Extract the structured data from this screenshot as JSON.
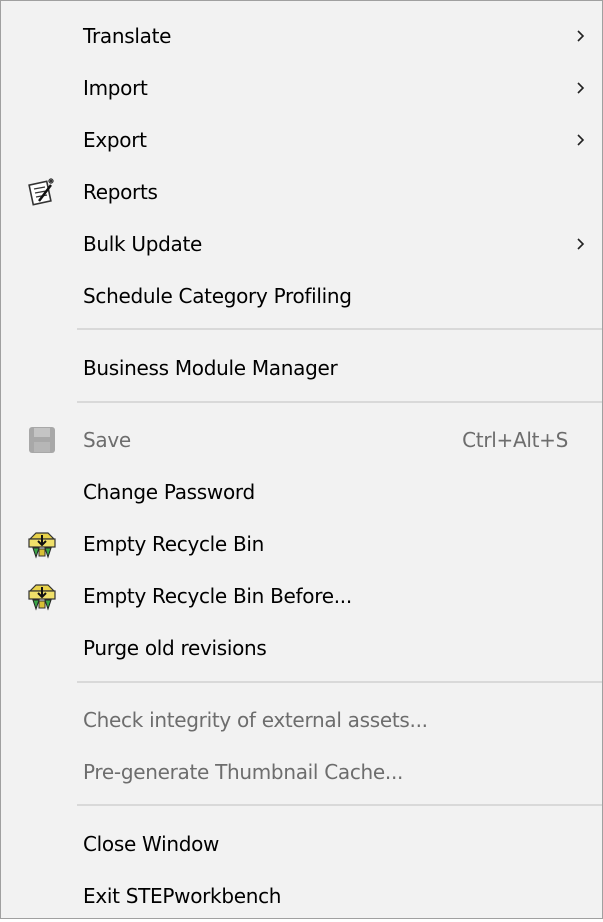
{
  "menu": {
    "items": {
      "translate": {
        "label": "Translate"
      },
      "import": {
        "label": "Import"
      },
      "export": {
        "label": "Export"
      },
      "reports": {
        "label": "Reports"
      },
      "bulk_update": {
        "label": "Bulk Update"
      },
      "schedule_category_profiling": {
        "label": "Schedule Category Profiling"
      },
      "business_module_manager": {
        "label": "Business Module Manager"
      },
      "save": {
        "label": "Save",
        "shortcut": "Ctrl+Alt+S"
      },
      "change_password": {
        "label": "Change Password"
      },
      "empty_recycle_bin": {
        "label": "Empty Recycle Bin"
      },
      "empty_recycle_bin_before": {
        "label": "Empty Recycle Bin Before..."
      },
      "purge_old_revisions": {
        "label": "Purge old revisions"
      },
      "check_integrity": {
        "label": "Check integrity of external assets..."
      },
      "pregenerate_thumbnail_cache": {
        "label": "Pre-generate Thumbnail Cache..."
      },
      "close_window": {
        "label": "Close Window"
      },
      "exit": {
        "label": "Exit STEPworkbench"
      }
    },
    "icons": {
      "reports": "report-wand-icon",
      "save": "save-disk-icon",
      "empty_recycle_bin": "recycle-bin-icon",
      "empty_recycle_bin_before": "recycle-bin-icon",
      "submenu": "chevron-right-icon"
    },
    "colors": {
      "background": "#f2f2f2",
      "text": "#000000",
      "disabled_text": "#6d6d6d",
      "separator": "#d9d9d9",
      "border": "#a0a0a0"
    }
  }
}
